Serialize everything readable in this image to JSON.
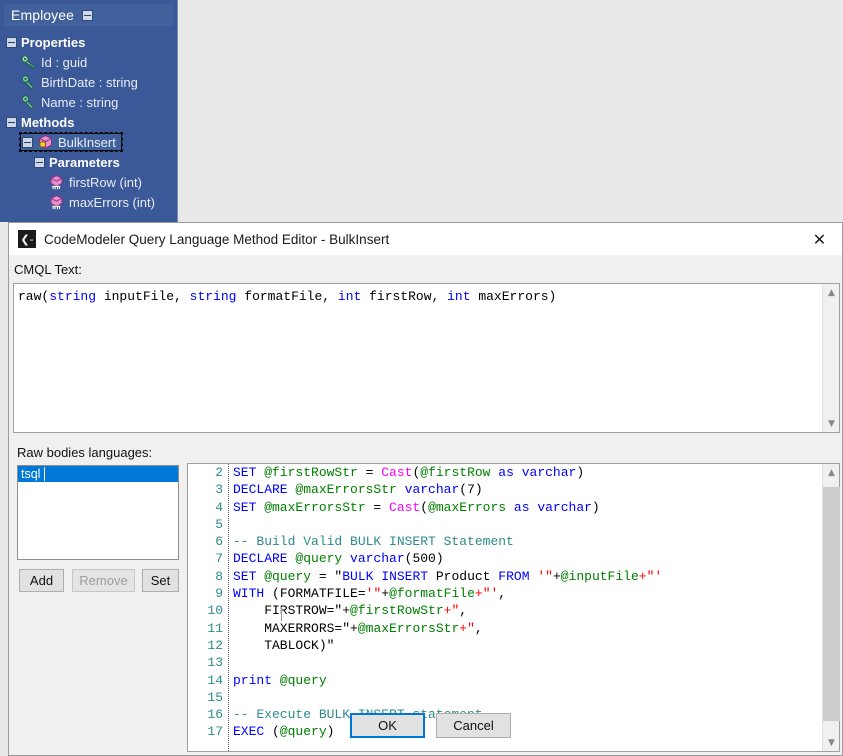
{
  "tree_window": {
    "title": "Employee",
    "collapse_icon": "minus-box-icon",
    "nodes": [
      {
        "label": "Properties",
        "icon": "minus-box-icon",
        "kind": "group",
        "indent": 0
      },
      {
        "label": "Id : guid",
        "icon": "key-property-icon",
        "kind": "property",
        "indent": 1
      },
      {
        "label": "BirthDate : string",
        "icon": "property-icon",
        "kind": "property",
        "indent": 1
      },
      {
        "label": "Name : string",
        "icon": "property-icon",
        "kind": "property",
        "indent": 1
      },
      {
        "label": "Methods",
        "icon": "minus-box-icon",
        "kind": "group",
        "indent": 0
      },
      {
        "label": "BulkInsert",
        "icon": "method-locked-icon",
        "kind": "method",
        "indent": 1,
        "selected": true
      },
      {
        "label": "Parameters",
        "icon": "minus-box-icon",
        "kind": "group",
        "indent": 2
      },
      {
        "label": "firstRow (int)",
        "icon": "parameter-icon",
        "kind": "parameter",
        "indent": 3
      },
      {
        "label": "maxErrors (int)",
        "icon": "parameter-icon",
        "kind": "parameter",
        "indent": 3
      }
    ]
  },
  "dialog": {
    "title": "CodeModeler Query Language Method Editor - BulkInsert",
    "app_icon_glyph": "❮-",
    "close_glyph": "✕",
    "cmql_label": "CMQL Text:",
    "cmql_text_segments": [
      {
        "t": "raw(",
        "c": ""
      },
      {
        "t": "string",
        "c": "kw-blue"
      },
      {
        "t": " inputFile, ",
        "c": ""
      },
      {
        "t": "string",
        "c": "kw-blue"
      },
      {
        "t": " formatFile, ",
        "c": ""
      },
      {
        "t": "int",
        "c": "kw-blue"
      },
      {
        "t": " firstRow, ",
        "c": ""
      },
      {
        "t": "int",
        "c": "kw-blue"
      },
      {
        "t": " maxErrors)",
        "c": ""
      }
    ],
    "languages_label": "Raw bodies languages:",
    "languages": [
      "tsql"
    ],
    "selected_language": "tsql",
    "buttons": {
      "add": "Add",
      "remove": "Remove",
      "remove_disabled": true,
      "set": "Set",
      "ok": "OK",
      "cancel": "Cancel"
    },
    "code": {
      "first_visible_line": 2,
      "line_numbers": [
        2,
        3,
        4,
        5,
        6,
        7,
        8,
        9,
        10,
        11,
        12,
        13,
        14,
        15,
        16,
        17
      ],
      "lines": [
        {
          "n": 2,
          "segs": [
            {
              "t": "SET",
              "c": "c-kw"
            },
            {
              "t": " @firstRowStr",
              "c": "c-var"
            },
            {
              "t": " = ",
              "c": ""
            },
            {
              "t": "Cast",
              "c": "c-fn"
            },
            {
              "t": "(",
              "c": ""
            },
            {
              "t": "@firstRow",
              "c": "c-var"
            },
            {
              "t": " ",
              "c": ""
            },
            {
              "t": "as",
              "c": "c-kw"
            },
            {
              "t": " ",
              "c": ""
            },
            {
              "t": "varchar",
              "c": "c-kw"
            },
            {
              "t": ")",
              "c": ""
            }
          ]
        },
        {
          "n": 3,
          "segs": [
            {
              "t": "DECLARE",
              "c": "c-kw"
            },
            {
              "t": " @maxErrorsStr",
              "c": "c-var"
            },
            {
              "t": " ",
              "c": ""
            },
            {
              "t": "varchar",
              "c": "c-kw"
            },
            {
              "t": "(",
              "c": ""
            },
            {
              "t": "7",
              "c": "c-num"
            },
            {
              "t": ")",
              "c": ""
            }
          ]
        },
        {
          "n": 4,
          "segs": [
            {
              "t": "SET",
              "c": "c-kw"
            },
            {
              "t": " @maxErrorsStr",
              "c": "c-var"
            },
            {
              "t": " = ",
              "c": ""
            },
            {
              "t": "Cast",
              "c": "c-fn"
            },
            {
              "t": "(",
              "c": ""
            },
            {
              "t": "@maxErrors",
              "c": "c-var"
            },
            {
              "t": " ",
              "c": ""
            },
            {
              "t": "as",
              "c": "c-kw"
            },
            {
              "t": " ",
              "c": ""
            },
            {
              "t": "varchar",
              "c": "c-kw"
            },
            {
              "t": ")",
              "c": ""
            }
          ]
        },
        {
          "n": 5,
          "segs": [
            {
              "t": "",
              "c": ""
            }
          ]
        },
        {
          "n": 6,
          "segs": [
            {
              "t": "-- Build Valid BULK INSERT Statement",
              "c": "c-cmt"
            }
          ]
        },
        {
          "n": 7,
          "segs": [
            {
              "t": "DECLARE",
              "c": "c-kw"
            },
            {
              "t": " @query",
              "c": "c-var"
            },
            {
              "t": " ",
              "c": ""
            },
            {
              "t": "varchar",
              "c": "c-kw"
            },
            {
              "t": "(",
              "c": ""
            },
            {
              "t": "500",
              "c": "c-num"
            },
            {
              "t": ")",
              "c": ""
            }
          ]
        },
        {
          "n": 8,
          "segs": [
            {
              "t": "SET",
              "c": "c-kw"
            },
            {
              "t": " @query",
              "c": "c-var"
            },
            {
              "t": " = \"",
              "c": ""
            },
            {
              "t": "BULK",
              "c": "c-kw"
            },
            {
              "t": " ",
              "c": ""
            },
            {
              "t": "INSERT",
              "c": "c-kw"
            },
            {
              "t": " Product ",
              "c": ""
            },
            {
              "t": "FROM",
              "c": "c-kw"
            },
            {
              "t": " ",
              "c": ""
            },
            {
              "t": "'\"",
              "c": "c-str"
            },
            {
              "t": "+",
              "c": ""
            },
            {
              "t": "@inputFile",
              "c": "c-var"
            },
            {
              "t": "+\"'",
              "c": "c-str"
            }
          ]
        },
        {
          "n": 9,
          "segs": [
            {
              "t": "WITH",
              "c": "c-kw"
            },
            {
              "t": " (FORMATFILE=",
              "c": ""
            },
            {
              "t": "'\"",
              "c": "c-str"
            },
            {
              "t": "+",
              "c": ""
            },
            {
              "t": "@formatFile",
              "c": "c-var"
            },
            {
              "t": "+\"'",
              "c": "c-str"
            },
            {
              "t": ",",
              "c": ""
            }
          ]
        },
        {
          "n": 10,
          "segs": [
            {
              "t": "    FIRSTROW=\"",
              "c": ""
            },
            {
              "t": "+",
              "c": ""
            },
            {
              "t": "@firstRowStr",
              "c": "c-var"
            },
            {
              "t": "+\"",
              "c": "c-str"
            },
            {
              "t": ",",
              "c": ""
            }
          ]
        },
        {
          "n": 11,
          "segs": [
            {
              "t": "    MAXERRORS=\"",
              "c": ""
            },
            {
              "t": "+",
              "c": ""
            },
            {
              "t": "@maxErrorsStr",
              "c": "c-var"
            },
            {
              "t": "+\"",
              "c": "c-str"
            },
            {
              "t": ",",
              "c": ""
            }
          ]
        },
        {
          "n": 12,
          "segs": [
            {
              "t": "    TABLOCK)\"",
              "c": ""
            }
          ]
        },
        {
          "n": 13,
          "segs": [
            {
              "t": "",
              "c": ""
            }
          ]
        },
        {
          "n": 14,
          "segs": [
            {
              "t": "print",
              "c": "c-kw"
            },
            {
              "t": " @query",
              "c": "c-var"
            }
          ]
        },
        {
          "n": 15,
          "segs": [
            {
              "t": "",
              "c": ""
            }
          ]
        },
        {
          "n": 16,
          "segs": [
            {
              "t": "-- Execute BULK INSERT statement",
              "c": "c-cmt"
            }
          ]
        },
        {
          "n": 17,
          "segs": [
            {
              "t": "EXEC",
              "c": "c-kw"
            },
            {
              "t": " (",
              "c": ""
            },
            {
              "t": "@query",
              "c": "c-var"
            },
            {
              "t": ")",
              "c": ""
            }
          ]
        }
      ]
    }
  },
  "colors": {
    "tree_bg": "#3b5998",
    "tree_header": "#41619c",
    "selection_blue": "#0078d7",
    "keyword_blue": "#0000ff",
    "variable_green": "#008000",
    "function_magenta": "#ff00ff",
    "comment_teal": "#2e8b8b",
    "string_red": "#ff0000",
    "linenum_teal": "#2e8b8b",
    "dialog_bg": "#f0f0f0"
  }
}
